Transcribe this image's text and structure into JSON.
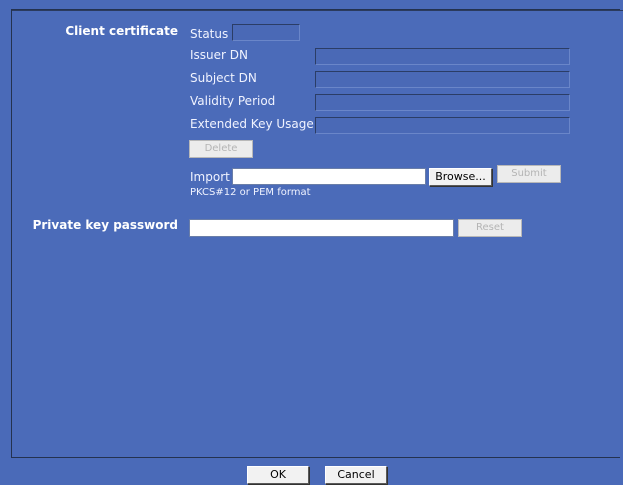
{
  "client_certificate": {
    "section_label": "Client certificate",
    "status_label": "Status",
    "issuer_label": "Issuer DN",
    "subject_label": "Subject DN",
    "validity_label": "Validity Period",
    "eku_label": "Extended Key Usage",
    "delete_label": "Delete",
    "import_label": "Import",
    "browse_label": "Browse...",
    "submit_label": "Submit",
    "format_hint": "PKCS#12 or PEM format"
  },
  "private_key": {
    "section_label": "Private key password",
    "reset_label": "Reset"
  },
  "footer": {
    "ok_label": "OK",
    "cancel_label": "Cancel"
  }
}
